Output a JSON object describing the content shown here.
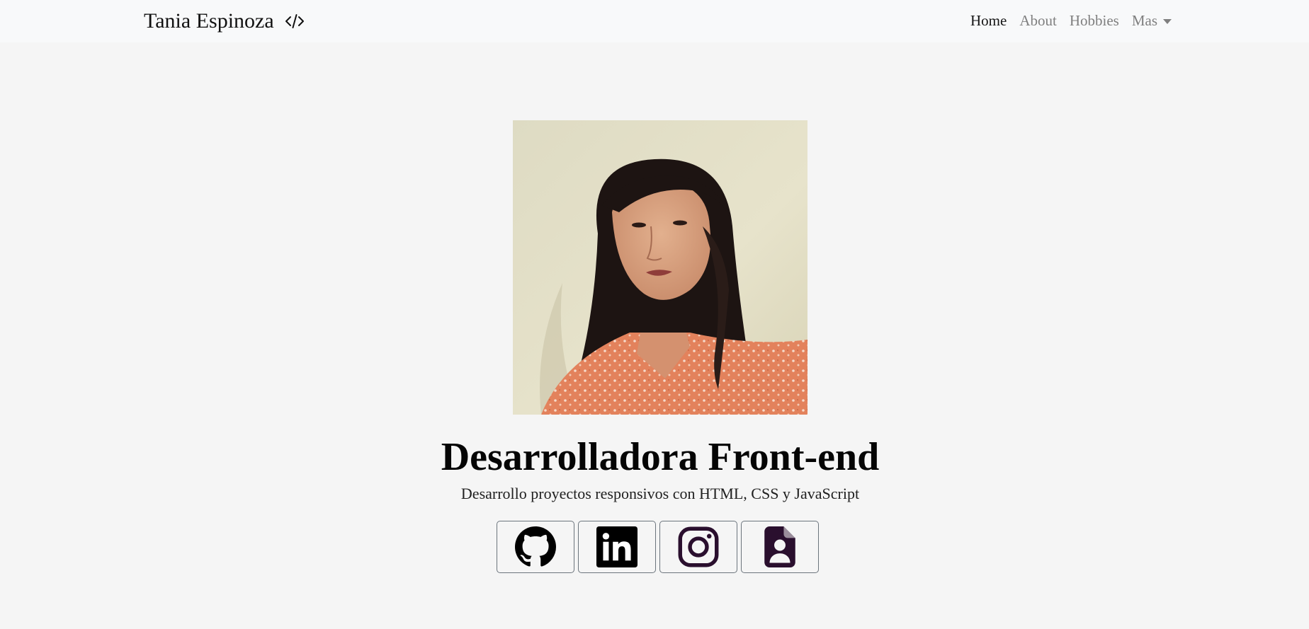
{
  "nav": {
    "brand": "Tania Espinoza",
    "brand_icon": "code-slash-icon",
    "links": [
      {
        "label": "Home",
        "active": true
      },
      {
        "label": "About",
        "active": false
      },
      {
        "label": "Hobbies",
        "active": false
      },
      {
        "label": "Mas",
        "active": false,
        "dropdown": true
      }
    ]
  },
  "hero": {
    "photo_alt": "Tania Espinoza",
    "title": "Desarrolladora Front-end",
    "subtitle": "Desarrollo proyectos responsivos con HTML, CSS y JavaScript"
  },
  "social": [
    {
      "name": "github-icon",
      "color": "#000000"
    },
    {
      "name": "linkedin-icon",
      "color": "#000000"
    },
    {
      "name": "instagram-icon",
      "color": "#2a0f2e"
    },
    {
      "name": "resume-file-icon",
      "color": "#2a0f2e"
    }
  ],
  "colors": {
    "page_bg": "#f5f5f5",
    "navbar_bg": "#f8f9fa",
    "nav_link": "#7f7f7f",
    "nav_active": "#151515",
    "button_border": "#6c757d"
  }
}
